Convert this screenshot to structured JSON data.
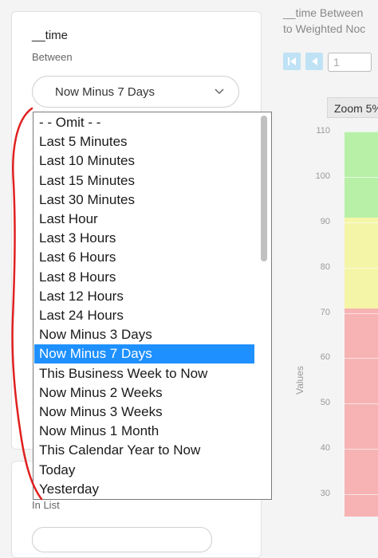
{
  "filter": {
    "field_title": "__time",
    "operator_label": "Between",
    "selected_value": "Now Minus 7 Days",
    "next_operator_label": "In List"
  },
  "dropdown": {
    "options": [
      "- - Omit - -",
      "Last 5 Minutes",
      "Last 10 Minutes",
      "Last 15 Minutes",
      "Last 30 Minutes",
      "Last Hour",
      "Last 3 Hours",
      "Last 6 Hours",
      "Last 8 Hours",
      "Last 12 Hours",
      "Last 24 Hours",
      "Now Minus 3 Days",
      "Now Minus 7 Days",
      "This Business Week to Now",
      "Now Minus 2 Weeks",
      "Now Minus 3 Weeks",
      "Now Minus 1 Month",
      "This Calendar Year to Now",
      "Today",
      "Yesterday"
    ],
    "selected_index": 12
  },
  "chart_panel": {
    "title_line1": "__time Between",
    "title_line2": "to Weighted Noc",
    "page_value": "1",
    "zoom_label": "Zoom 5%",
    "ylabel": "Values"
  },
  "chart_data": {
    "type": "area",
    "ylabel": "Values",
    "yticks": [
      110,
      100,
      90,
      80,
      70,
      60,
      50,
      40,
      30
    ],
    "bands": [
      {
        "color": "#b8f0a8",
        "from": 91,
        "to": 110
      },
      {
        "color": "#f5f5a8",
        "from": 71,
        "to": 91
      },
      {
        "color": "#f7b3b3",
        "from": 25,
        "to": 71
      }
    ]
  },
  "colors": {
    "selection": "#1e90ff",
    "annotation": "#e02020",
    "nav_button": "#bfe2f5"
  }
}
